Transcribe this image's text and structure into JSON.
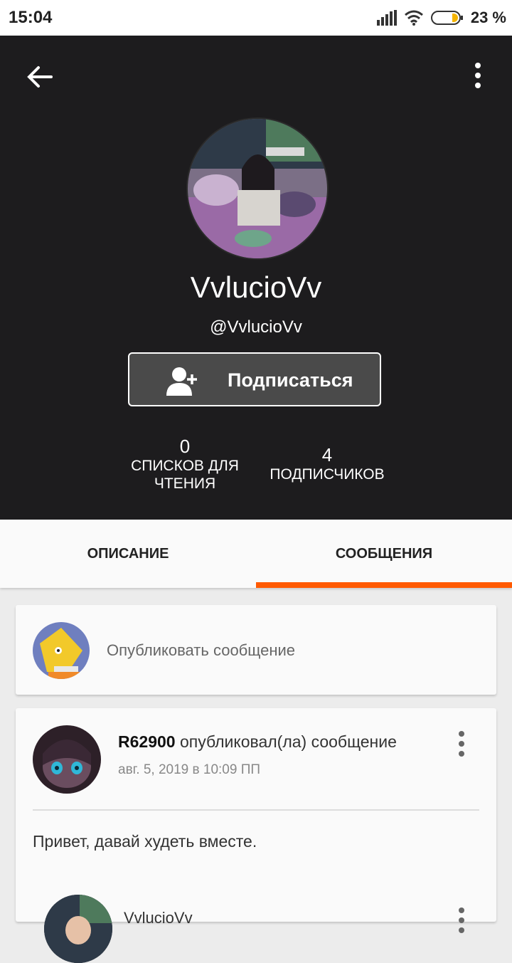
{
  "status_bar": {
    "time": "15:04",
    "battery": "23 %"
  },
  "profile": {
    "name": "VvlucioVv",
    "handle": "@VvlucioVv",
    "follow_label": "Подписаться",
    "stats": [
      {
        "value": "0",
        "label_line1": "СПИСКОВ ДЛЯ",
        "label_line2": "ЧТЕНИЯ"
      },
      {
        "value": "4",
        "label_line1": "ПОДПИСЧИКОВ"
      }
    ]
  },
  "tabs": [
    {
      "label": "ОПИСАНИЕ",
      "active": false
    },
    {
      "label": "СООБЩЕНИЯ",
      "active": true
    }
  ],
  "composer": {
    "placeholder": "Опубликовать сообщение"
  },
  "posts": [
    {
      "author": "R62900",
      "action": "опубликовал(ла) сообщение",
      "date": "авг. 5, 2019 в 10:09 ПП",
      "body": "Привет, давай худеть вместе."
    }
  ],
  "reply_preview": {
    "author": "VvlucioVv"
  },
  "colors": {
    "accent": "#ff5a00",
    "header_bg": "#1d1c1e"
  }
}
